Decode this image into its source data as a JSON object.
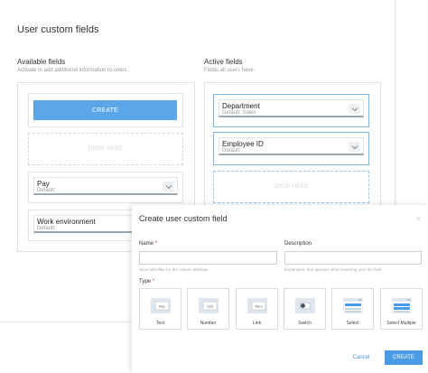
{
  "page": {
    "title": "User custom fields",
    "available": {
      "title": "Available fields",
      "desc": "Activate to add additional information to users.",
      "create_label": "CREATE",
      "drop_label": "DROP HERE",
      "fields": [
        {
          "label": "Pay",
          "default": "Default:"
        },
        {
          "label": "Work environment",
          "default": "Default:"
        }
      ]
    },
    "active": {
      "title": "Active fields",
      "desc": "Fields all users have.",
      "drop_label": "DROP HERE",
      "fields": [
        {
          "label": "Department",
          "default": "Default: Sales"
        },
        {
          "label": "Employee ID",
          "default": "Default:"
        }
      ]
    }
  },
  "modal": {
    "title": "Create user custom field",
    "close_icon": "×",
    "name_label": "Name",
    "required_mark": "*",
    "name_value": "",
    "name_hint": "Short identifier for the custom attribute.",
    "description_label": "Description",
    "description_value": "",
    "description_hint": "Explanation that appears when hovering over the field.",
    "type_label": "Type",
    "types": [
      {
        "label": "Text",
        "icon": "text-type-icon",
        "icon_text": "Abc"
      },
      {
        "label": "Number",
        "icon": "number-type-icon",
        "icon_text": "123"
      },
      {
        "label": "Link",
        "icon": "link-type-icon",
        "icon_text": "http://"
      },
      {
        "label": "Switch",
        "icon": "switch-type-icon"
      },
      {
        "label": "Select",
        "icon": "select-type-icon"
      },
      {
        "label": "Select Multiple",
        "icon": "select-multiple-type-icon"
      }
    ],
    "cancel_label": "Cancel",
    "create_label": "CREATE"
  },
  "colors": {
    "accent": "#5aa6e8",
    "active_border": "#7fb7da",
    "required": "#e53935"
  }
}
